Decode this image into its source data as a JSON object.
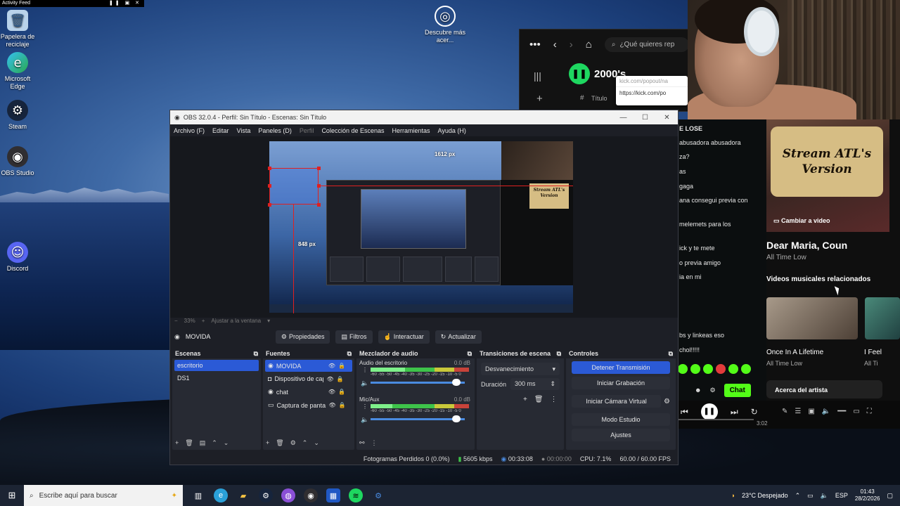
{
  "activity_feed": {
    "title": "Activity Feed"
  },
  "desktop_icons": [
    {
      "label": "Papelera de reciclaje",
      "icon": "recycle-bin-icon",
      "glyph": "🗑"
    },
    {
      "label": "Microsoft Edge",
      "icon": "edge-icon",
      "glyph": "e"
    },
    {
      "label": "Steam",
      "icon": "steam-icon",
      "glyph": "⚙"
    },
    {
      "label": "OBS Studio",
      "icon": "obs-icon",
      "glyph": "◉"
    },
    {
      "label": "Discord",
      "icon": "discord-icon",
      "glyph": "☺"
    },
    {
      "label": "Descubre más acer...",
      "icon": "discover-icon",
      "glyph": "◎"
    }
  ],
  "spotify": {
    "search_placeholder": "¿Qué quieres rep",
    "now_playing": "2000's",
    "column_title": "Título",
    "hash": "#",
    "popup_url_1": "kick.com/popout/na",
    "popup_url_2": "https://kick.com/po"
  },
  "kick_chat": {
    "lines": [
      "E LOSE",
      "abusadora abusadora",
      "za?",
      "as",
      "gaga",
      "ana consegui previa con",
      "melemets para los",
      "ick y te mete",
      "o previa amigo",
      "ia en mi",
      "bs y linkeas eso",
      "chol!!!!!"
    ],
    "chat_button": "Chat"
  },
  "youtube": {
    "poster_text": "Stream ATL's Version",
    "change_video": "Cambiar a video",
    "song_title": "Dear Maria, Coun",
    "song_artist": "All Time Low",
    "related_heading": "Videos musicales relacionados",
    "video1_title": "Once In A Lifetime",
    "video1_artist": "All Time Low",
    "video2_title": "I Feel",
    "video2_artist": "All Ti",
    "about_artist": "Acerca del artista",
    "time": "3:02"
  },
  "obs": {
    "window_title": "OBS 32.0.4 - Perfil: Sin Título - Escenas: Sin Título",
    "menu": [
      "Archivo (F)",
      "Editar",
      "Vista",
      "Paneles (D)",
      "Perfil",
      "Colección de Escenas",
      "Herramientas",
      "Ayuda (H)"
    ],
    "measure_horizontal": "1612 px",
    "measure_vertical": "848 px",
    "zoom_level": "33%",
    "fit_label": "Ajustar a la ventana",
    "selected_source": "MOVIDA",
    "toolbar": {
      "properties": "Propiedades",
      "filters": "Filtros",
      "interact": "Interactuar",
      "refresh": "Actualizar"
    },
    "scenes": {
      "title": "Escenas",
      "items": [
        {
          "label": "escritorio",
          "active": true
        },
        {
          "label": "DS1",
          "active": false
        }
      ]
    },
    "sources": {
      "title": "Fuentes",
      "items": [
        {
          "label": "MOVIDA",
          "icon": "globe-icon",
          "active": true
        },
        {
          "label": "Dispositivo de cap",
          "icon": "camera-icon",
          "active": false
        },
        {
          "label": "chat",
          "icon": "globe-icon",
          "active": false
        },
        {
          "label": "Captura de panta",
          "icon": "monitor-icon",
          "active": false
        }
      ]
    },
    "mixer": {
      "title": "Mezclador de audio",
      "scale": "-60 -55 -50 -45 -40 -35 -30 -25 -20 -15 -10 -5 0",
      "channels": [
        {
          "name": "Audio del escritorio",
          "db": "0.0 dB",
          "level": 0.35
        },
        {
          "name": "Mic/Aux",
          "db": "0.0 dB",
          "level": 0.22
        }
      ]
    },
    "transitions": {
      "title": "Transiciones de escena",
      "selected": "Desvanecimiento",
      "duration_label": "Duración",
      "duration_value": "300 ms"
    },
    "controls": {
      "title": "Controles",
      "stop_stream": "Detener Transmisión",
      "start_recording": "Iniciar Grabación",
      "start_virtual_cam": "Iniciar Cámara Virtual",
      "studio_mode": "Modo Estudio",
      "settings": "Ajustes"
    },
    "status": {
      "dropped_frames": "Fotogramas Perdidos 0 (0.0%)",
      "bitrate": "5605 kbps",
      "stream_time": "00:33:08",
      "record_time": "00:00:00",
      "cpu": "CPU: 7.1%",
      "fps": "60.00 / 60.00 FPS"
    }
  },
  "taskbar": {
    "search_placeholder": "Escribe aquí para buscar",
    "weather": "23°C  Despejado",
    "language": "ESP",
    "time": "01:43",
    "date": "28/2/2026"
  }
}
